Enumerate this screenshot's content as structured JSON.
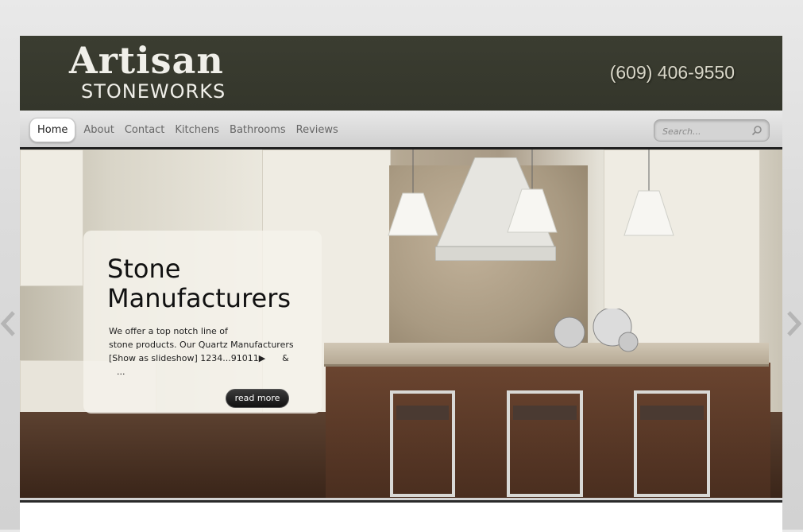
{
  "header": {
    "logo_main": "Artisan",
    "logo_sub": "STONEWORKS",
    "phone": "(609) 406-9550"
  },
  "nav": {
    "items": [
      {
        "label": "Home",
        "active": true
      },
      {
        "label": "About"
      },
      {
        "label": "Contact"
      },
      {
        "label": "Kitchens"
      },
      {
        "label": "Bathrooms"
      },
      {
        "label": "Reviews"
      }
    ]
  },
  "search": {
    "placeholder": "Search..."
  },
  "slide": {
    "title_line1": "Stone",
    "title_line2": "Manufacturers",
    "body_line1": "We offer a top notch line of",
    "body_line2": "stone products. Our Quartz Manufacturers",
    "body_line3": "[Show as slideshow] 1234...91011▶      &",
    "body_line4": "...",
    "button_label": "read more"
  },
  "icons": {
    "search": "search-icon",
    "prev": "chevron-left-icon",
    "next": "chevron-right-icon"
  },
  "colors": {
    "header_bg": "#3b3d31",
    "nav_bg": "#dcdcdc",
    "button_bg": "#1a1a1a"
  }
}
